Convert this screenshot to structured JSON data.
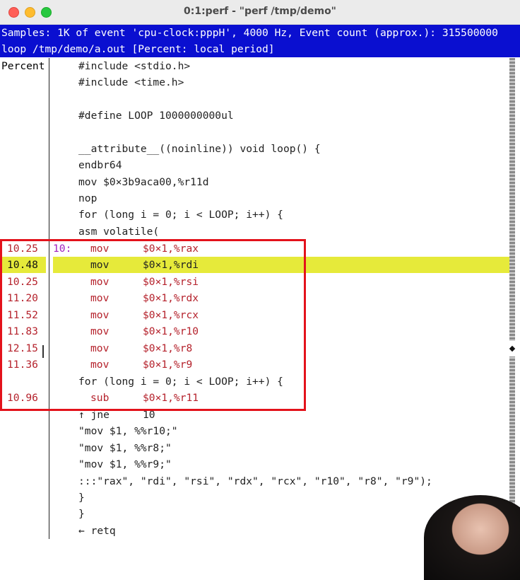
{
  "window": {
    "title": "0:1:perf - \"perf /tmp/demo\""
  },
  "header": {
    "line1": "Samples: 1K of event 'cpu-clock:pppH', 4000 Hz, Event count (approx.): 315500000",
    "line2": "loop  /tmp/demo/a.out [Percent: local period]"
  },
  "left_header": "Percent",
  "code_lines": [
    "#include <stdio.h>",
    "#include <time.h>",
    "",
    "#define LOOP 1000000000ul",
    "",
    "__attribute__((noinline)) void loop() {",
    "  endbr64",
    "  mov     $0×3b9aca00,%r11d",
    "  nop",
    "for (long i = 0; i < LOOP; i++) {",
    "asm volatile("
  ],
  "hot_rows": [
    {
      "percent": "10.25",
      "label": "10:",
      "op": "mov",
      "operand": "$0×1,%rax"
    },
    {
      "percent": "10.48",
      "label": "",
      "op": "mov",
      "operand": "$0×1,%rdi"
    },
    {
      "percent": "10.25",
      "label": "",
      "op": "mov",
      "operand": "$0×1,%rsi"
    },
    {
      "percent": "11.20",
      "label": "",
      "op": "mov",
      "operand": "$0×1,%rdx"
    },
    {
      "percent": "11.52",
      "label": "",
      "op": "mov",
      "operand": "$0×1,%rcx"
    },
    {
      "percent": "11.83",
      "label": "",
      "op": "mov",
      "operand": "$0×1,%r10"
    },
    {
      "percent": "12.15",
      "label": "",
      "op": "mov",
      "operand": "$0×1,%r8"
    },
    {
      "percent": "11.36",
      "label": "",
      "op": "mov",
      "operand": "$0×1,%r9"
    }
  ],
  "for_line_2": "for (long i = 0; i < LOOP; i++) {",
  "sub_row": {
    "percent": "10.96",
    "op": "sub",
    "operand": "$0×1,%r11"
  },
  "jne_row": {
    "op": "↑ jne",
    "operand": "10"
  },
  "tail_lines": [
    "\"mov $1, %%r10;\"",
    "\"mov $1, %%r8;\"",
    "\"mov $1, %%r9;\"",
    ":::\"rax\", \"rdi\", \"rsi\", \"rdx\", \"rcx\", \"r10\", \"r8\", \"r9\");",
    "}",
    "}",
    "← retq"
  ],
  "colors": {
    "header_bg": "#0a0fd0",
    "highlight": "#e6ea3a",
    "percent_text": "#b5222c",
    "label": "#a020c0",
    "annotation_box": "#e3121b"
  }
}
